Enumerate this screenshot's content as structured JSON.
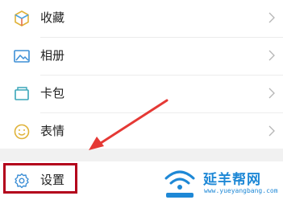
{
  "menu": {
    "items": [
      {
        "label": "收藏",
        "icon": "cube-icon"
      },
      {
        "label": "相册",
        "icon": "photo-album-icon"
      },
      {
        "label": "卡包",
        "icon": "card-wallet-icon"
      },
      {
        "label": "表情",
        "icon": "smiley-icon"
      }
    ],
    "settings": {
      "label": "设置",
      "icon": "gear-icon"
    }
  },
  "watermark": {
    "title": "延羊帮网",
    "url": "www.yueyangbang.com"
  },
  "colors": {
    "highlight": "#b3001b",
    "arrow": "#e53935",
    "watermark": "#1e88d6"
  }
}
